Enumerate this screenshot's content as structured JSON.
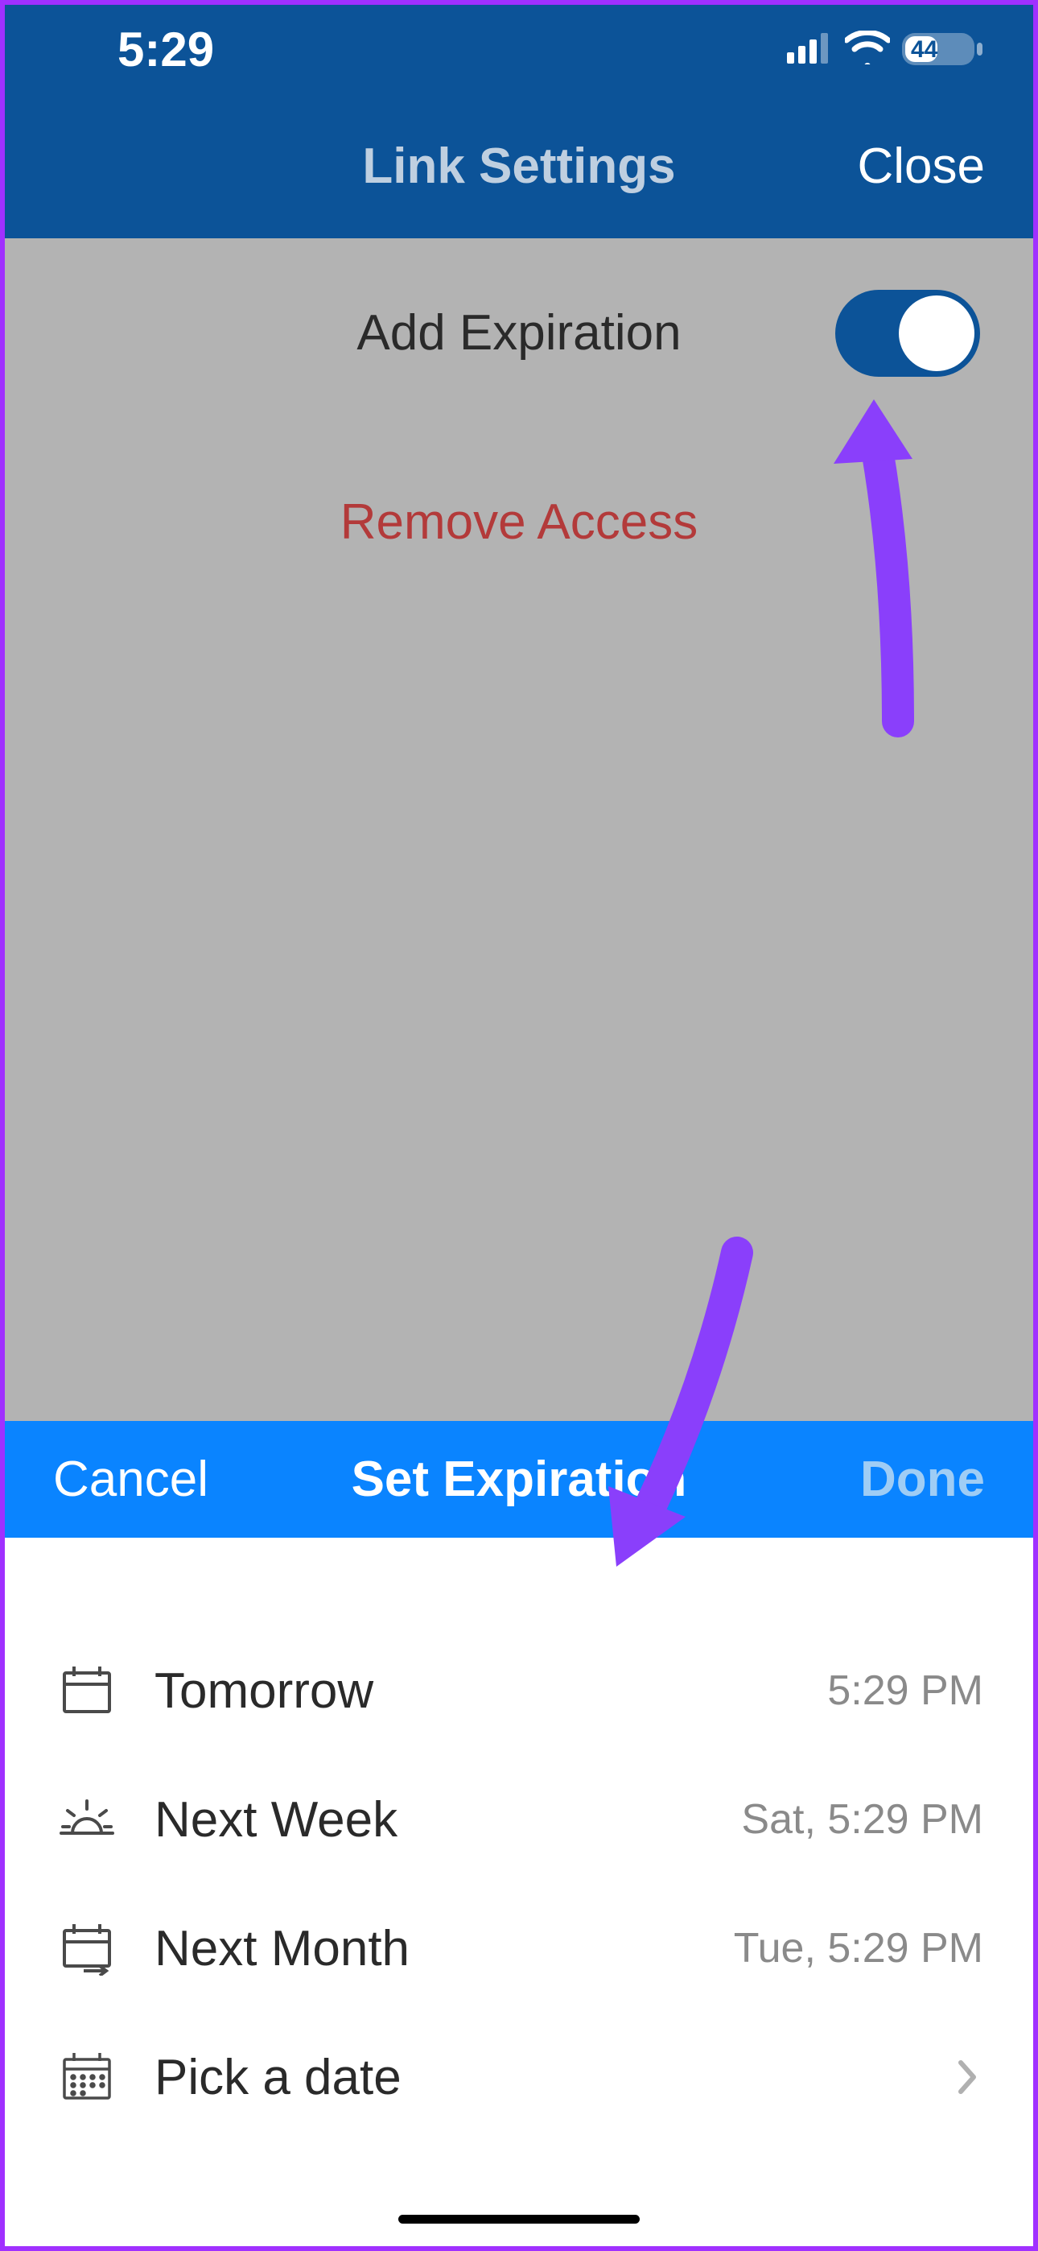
{
  "status": {
    "time": "5:29",
    "battery": "44"
  },
  "nav": {
    "title": "Link Settings",
    "close": "Close"
  },
  "settings": {
    "add_expiration_label": "Add Expiration",
    "add_expiration_on": true,
    "remove_access_label": "Remove Access"
  },
  "sheet": {
    "cancel": "Cancel",
    "title": "Set Expiration",
    "done": "Done",
    "options": [
      {
        "label": "Tomorrow",
        "sub": "5:29 PM"
      },
      {
        "label": "Next Week",
        "sub": "Sat, 5:29 PM"
      },
      {
        "label": "Next Month",
        "sub": "Tue, 5:29 PM"
      },
      {
        "label": "Pick a date",
        "sub": ""
      }
    ]
  },
  "colors": {
    "brand": "#0c5398",
    "accent": "#0a84ff",
    "danger": "#b33a3a",
    "annotation": "#8a3ffb"
  }
}
